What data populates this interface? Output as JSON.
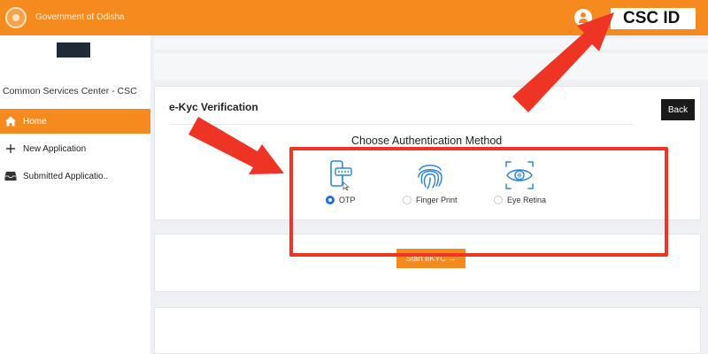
{
  "header": {
    "gov_title": "Government of Odisha",
    "csc_id_label": "CSC ID"
  },
  "sidebar": {
    "title": "Common Services Center - CSC",
    "items": [
      {
        "label": "Home",
        "active": true
      },
      {
        "label": "New Application",
        "active": false
      },
      {
        "label": "Submitted Applicatio..",
        "active": false
      }
    ]
  },
  "ekyc": {
    "title": "e-Kyc Verification",
    "back_label": "Back",
    "choose_title": "Choose Authentication Method",
    "methods": [
      {
        "label": "OTP",
        "icon": "phone-otp-icon",
        "selected": true
      },
      {
        "label": "Finger Print",
        "icon": "fingerprint-icon",
        "selected": false
      },
      {
        "label": "Eye Retina",
        "icon": "eye-retina-icon",
        "selected": false
      }
    ],
    "start_label": "Start eKYC →"
  },
  "colors": {
    "brand_orange": "#f58a1f",
    "annotation_red": "#ee3424",
    "radio_blue": "#1f6fe0",
    "back_button": "#1a1a1a"
  }
}
